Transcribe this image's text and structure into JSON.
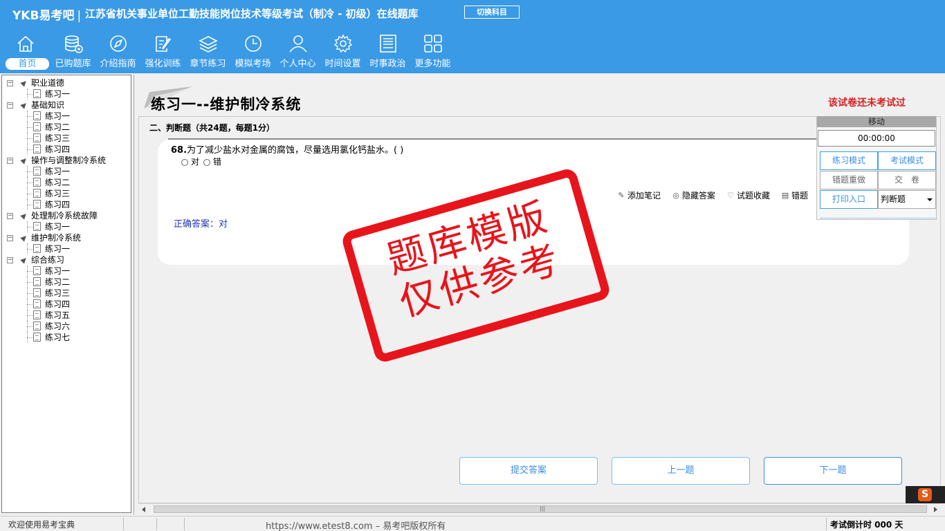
{
  "header": {
    "brand": "YKB易考吧",
    "title": "江苏省机关事业单位工勤技能岗位技术等级考试（制冷 - 初级）在线题库",
    "switch_label": "切换科目",
    "bg_color": "#3a9ae6"
  },
  "nav": [
    {
      "label": "首页",
      "icon": "home-icon"
    },
    {
      "label": "已购题库",
      "icon": "database-icon"
    },
    {
      "label": "介绍指南",
      "icon": "compass-icon"
    },
    {
      "label": "强化训练",
      "icon": "edit-icon"
    },
    {
      "label": "章节练习",
      "icon": "layers-icon"
    },
    {
      "label": "模拟考场",
      "icon": "clock-icon"
    },
    {
      "label": "个人中心",
      "icon": "user-icon"
    },
    {
      "label": "时间设置",
      "icon": "gear-icon"
    },
    {
      "label": "时事政治",
      "icon": "news-icon"
    },
    {
      "label": "更多功能",
      "icon": "grid-icon"
    }
  ],
  "tree": [
    {
      "label": "职业道德",
      "children": [
        "练习一"
      ]
    },
    {
      "label": "基础知识",
      "children": [
        "练习一",
        "练习二",
        "练习三",
        "练习四"
      ]
    },
    {
      "label": "操作与调整制冷系统",
      "children": [
        "练习一",
        "练习二",
        "练习三",
        "练习四"
      ]
    },
    {
      "label": "处理制冷系统故障",
      "children": [
        "练习一"
      ]
    },
    {
      "label": "维护制冷系统",
      "children": [
        "练习一"
      ]
    },
    {
      "label": "综合练习",
      "children": [
        "练习一",
        "练习二",
        "练习三",
        "练习四",
        "练习五",
        "练习六",
        "练习七"
      ]
    }
  ],
  "main": {
    "page_title": "练习一--维护制冷系统",
    "not_taken": "该试卷还未考试过",
    "section_head": "二、判断题（共24题，每题1分）",
    "question_number": "68.",
    "question_text": "为了减少盐水对金属的腐蚀，尽量选用氯化钙盐水。( )",
    "option_true": "对",
    "option_false": "错",
    "tools": {
      "add_note": "添加笔记",
      "hide_answer": "隐藏答案",
      "favorite": "试题收藏",
      "error": "错题"
    },
    "answer": "正确答案：对",
    "stamp_line1": "题库模版",
    "stamp_line2": "仅供参考"
  },
  "panel": {
    "move": "移动",
    "timer": "00:00:00",
    "practice_mode": "练习模式",
    "exam_mode": "考试模式",
    "redo_wrong": "错题重做",
    "submit_paper": "交　卷",
    "print": "打印入口",
    "type_select": "判断题"
  },
  "bottom_buttons": {
    "submit": "提交答案",
    "prev": "上一题",
    "next": "下一题"
  },
  "status": {
    "welcome": "欢迎使用易考宝典",
    "url": "https://www.etest8.com – 易考吧版权所有",
    "countdown": "考试倒计时 000 天"
  },
  "ime": {
    "label": "S"
  }
}
